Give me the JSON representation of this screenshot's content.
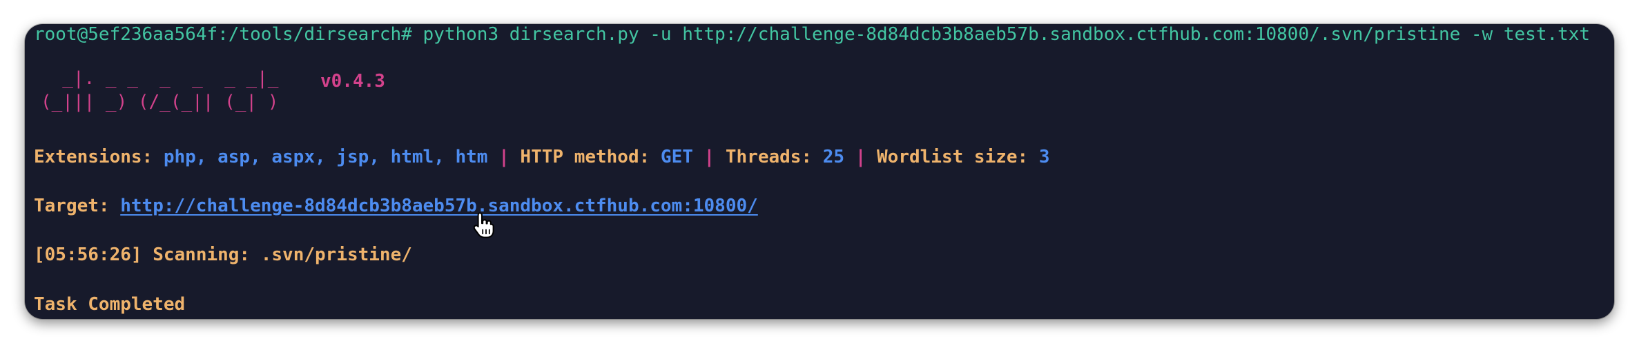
{
  "terminal": {
    "prompt": "root@5ef236aa564f:/tools/dirsearch#",
    "command": "python3 dirsearch.py -u http://challenge-8d84dcb3b8aeb57b.sandbox.ctfhub.com:10800/.svn/pristine -w test.txt",
    "banner_line1": "  _|. _ _  _  _  _ _|_",
    "banner_line2": "(_||| _) (/_(_|| (_| )",
    "version": "v0.4.3",
    "config": {
      "extensions_label": "Extensions:",
      "extensions_value": "php, asp, aspx, jsp, html, htm",
      "separator": "|",
      "method_label": "HTTP method:",
      "method_value": "GET",
      "threads_label": "Threads:",
      "threads_value": "25",
      "wordlist_label": "Wordlist size:",
      "wordlist_value": "3"
    },
    "target_label": "Target:",
    "target_url": "http://challenge-8d84dcb3b8aeb57b.sandbox.ctfhub.com:10800/",
    "scan_time": "[05:56:26]",
    "scan_label": "Scanning:",
    "scan_path": ".svn/pristine/",
    "completed": "Task Completed"
  },
  "colors": {
    "background": "#171a2b",
    "prompt": "#43c6a3",
    "banner": "#d3428c",
    "label": "#efb36c",
    "value": "#4d8cf0"
  },
  "cursor": "hand-pointer-icon"
}
